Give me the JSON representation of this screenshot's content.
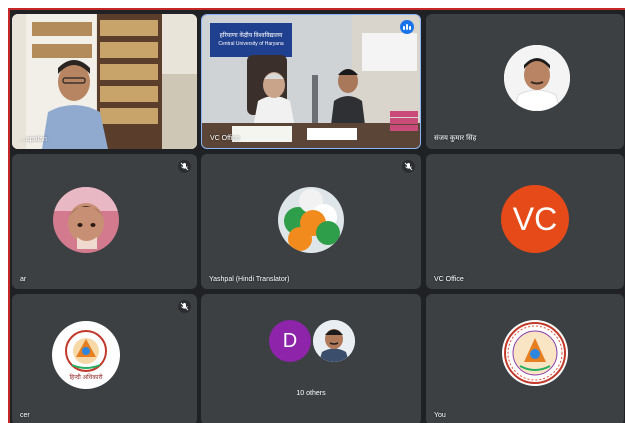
{
  "participants": [
    {
      "name": "...apalan",
      "kind": "video"
    },
    {
      "name": "VC Office",
      "kind": "video",
      "speaking": true,
      "banner_line1": "हरियाणा केंद्रीय विश्वविद्यालय",
      "banner_line2": "Central University of Haryana"
    },
    {
      "name": "संजय कुमार सिंह",
      "kind": "photo"
    },
    {
      "name": "ar",
      "kind": "photo",
      "muted": true
    },
    {
      "name": "Yashpal (Hindi Translator)",
      "kind": "photo",
      "muted": true
    },
    {
      "name": "VC Office",
      "kind": "letter",
      "initials": "VC",
      "avatar_color": "#e64a19"
    },
    {
      "name": "cer",
      "kind": "logo",
      "muted": true,
      "logo_caption": "हिन्दी अधिकारी"
    },
    {
      "name": "10 others",
      "kind": "group",
      "letter": "D",
      "letter_color": "#8e24aa"
    },
    {
      "name": "You",
      "kind": "logo"
    }
  ],
  "icons": {
    "muted": "mic-off-icon",
    "speaking": "speaking-indicator-icon"
  },
  "colors": {
    "grid_bg": "#202124",
    "tile_bg": "#3c4043",
    "accent": "#1a73e8",
    "window_border": "#c62828"
  }
}
